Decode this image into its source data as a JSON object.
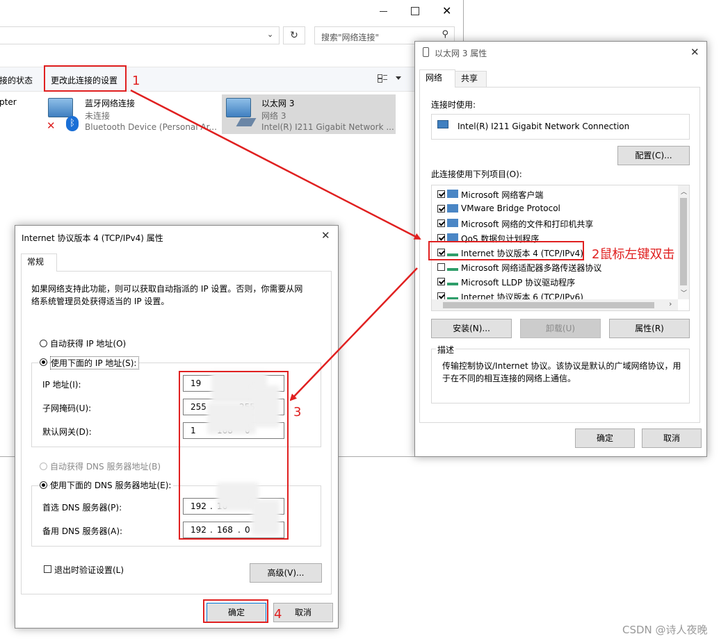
{
  "explorer": {
    "search_placeholder": "搜索\"网络连接\"",
    "toolbar_left": "接的状态",
    "toolbar_change": "更改此连接的设置",
    "left_partial": "pter",
    "adapters": [
      {
        "name": "蓝牙网络连接",
        "status": "未连接",
        "device": "Bluetooth Device (Personal Ar..."
      },
      {
        "name": "以太网 3",
        "status": "网络 3",
        "device": "Intel(R) I211 Gigabit Network ..."
      }
    ]
  },
  "eth_props": {
    "title": "以太网 3 属性",
    "tabs": [
      "网络",
      "共享"
    ],
    "connect_using_label": "连接时使用:",
    "adapter_name": "Intel(R) I211 Gigabit Network Connection",
    "configure_btn": "配置(C)...",
    "items_label": "此连接使用下列项目(O):",
    "items": [
      {
        "label": "Microsoft 网络客户端",
        "checked": true
      },
      {
        "label": "VMware Bridge Protocol",
        "checked": true
      },
      {
        "label": "Microsoft 网络的文件和打印机共享",
        "checked": true
      },
      {
        "label": "QoS 数据包计划程序",
        "checked": true
      },
      {
        "label": "Internet 协议版本 4 (TCP/IPv4)",
        "checked": true
      },
      {
        "label": "Microsoft 网络适配器多路传送器协议",
        "checked": false
      },
      {
        "label": "Microsoft LLDP 协议驱动程序",
        "checked": true
      },
      {
        "label": "Internet 协议版本 6 (TCP/IPv6)",
        "checked": true
      }
    ],
    "install_btn": "安装(N)...",
    "uninstall_btn": "卸载(U)",
    "properties_btn": "属性(R)",
    "description_label": "描述",
    "description_text_1": "传输控制协议/Internet 协议。该协议是默认的广域网络协议，用",
    "description_text_2": "于在不同的相互连接的网络上通信。",
    "ok_btn": "确定",
    "cancel_btn": "取消"
  },
  "ipv4": {
    "title": "Internet 协议版本 4 (TCP/IPv4) 属性",
    "tab": "常规",
    "intro_1": "如果网络支持此功能，则可以获取自动指派的 IP 设置。否则，你需要从网",
    "intro_2": "络系统管理员处获得适当的 IP 设置。",
    "auto_ip": "自动获得 IP 地址(O)",
    "manual_ip": "使用下面的 IP 地址(S):",
    "ip_label": "IP 地址(I):",
    "mask_label": "子网掩码(U):",
    "gw_label": "默认网关(D):",
    "ip_value": "19",
    "mask_value_a": "255",
    "mask_value_b": "255",
    "gw_value_a": "1",
    "gw_value_b": "168",
    "gw_value_c": "0",
    "auto_dns": "自动获得 DNS 服务器地址(B)",
    "manual_dns": "使用下面的 DNS 服务器地址(E):",
    "dns1_label": "首选 DNS 服务器(P):",
    "dns2_label": "备用 DNS 服务器(A):",
    "dns1_a": "192",
    "dns1_b": "16",
    "dns2_a": "192",
    "dns2_b": "168",
    "dns2_c": "0",
    "validate": "退出时验证设置(L)",
    "advanced_btn": "高级(V)...",
    "ok_btn": "确定",
    "cancel_btn": "取消"
  },
  "annotations": {
    "step1": "1",
    "step2": "2鼠标左键双击",
    "step3": "3",
    "step4": "4",
    "accent": "#e02020"
  },
  "watermark": "CSDN @诗人夜晚"
}
